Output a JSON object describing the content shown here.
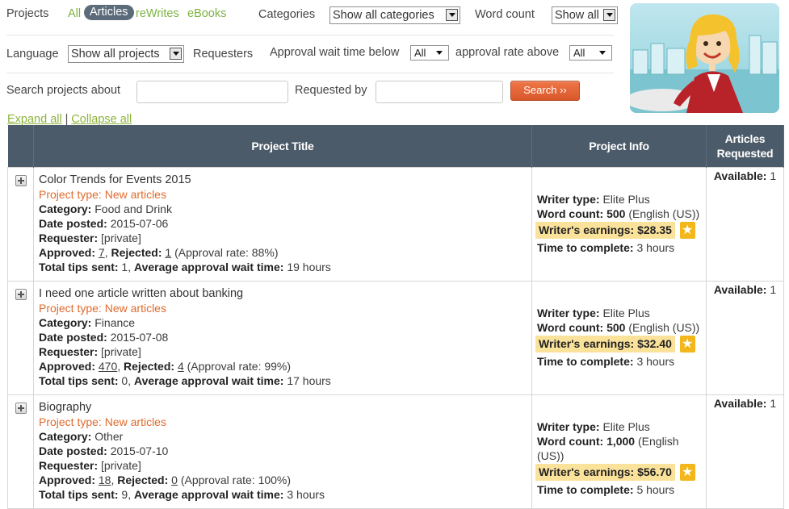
{
  "filters": {
    "projects_label": "Projects",
    "project_tabs": [
      {
        "label": "All",
        "active": false
      },
      {
        "label": "Articles",
        "active": true
      },
      {
        "label": "reWrites",
        "active": false
      },
      {
        "label": "eBooks",
        "active": false
      }
    ],
    "categories_label": "Categories",
    "categories_value": "Show all categories",
    "word_count_label": "Word count",
    "word_count_value": "Show all",
    "language_label": "Language",
    "language_value": "Show all projects",
    "requesters_label": "Requesters",
    "approval_wait_label": "Approval wait time below",
    "approval_wait_value": "All",
    "approval_rate_label": "approval rate above",
    "approval_rate_value": "All",
    "search_label": "Search projects about",
    "search_value": "",
    "requested_by_label": "Requested by",
    "requested_by_value": "",
    "search_button": "Search ››"
  },
  "expand": {
    "expand_all": "Expand all",
    "separator": "|",
    "collapse_all": "Collapse all"
  },
  "table": {
    "headers": [
      "Project Title",
      "Project Info",
      "Articles Requested"
    ],
    "rows": [
      {
        "title": "Color Trends for Events 2015",
        "project_type_label": "Project type:",
        "project_type": "New articles",
        "category_label": "Category:",
        "category": "Food and Drink",
        "date_label": "Date posted:",
        "date": "2015-07-06",
        "requester_label": "Requester:",
        "requester": "[private]",
        "approved_label": "Approved:",
        "approved": "7",
        "rejected_label": "Rejected:",
        "rejected": "1",
        "approval_rate_label": "(Approval rate:",
        "approval_rate": "88%)",
        "tips_label": "Total tips sent:",
        "tips": "1,",
        "wait_label": "Average approval wait time:",
        "wait": "19 hours",
        "writer_type_label": "Writer type:",
        "writer_type": "Elite Plus",
        "word_count_label": "Word count:",
        "word_count": "500",
        "language": "(English (US))",
        "earnings_label": "Writer's earnings:",
        "earnings": "$28.35",
        "time_label": "Time to complete:",
        "time": "3 hours",
        "available_label": "Available:",
        "available": "1"
      },
      {
        "title": "I need one article written about banking",
        "project_type_label": "Project type:",
        "project_type": "New articles",
        "category_label": "Category:",
        "category": "Finance",
        "date_label": "Date posted:",
        "date": "2015-07-08",
        "requester_label": "Requester:",
        "requester": "[private]",
        "approved_label": "Approved:",
        "approved": "470",
        "rejected_label": "Rejected:",
        "rejected": "4",
        "approval_rate_label": "(Approval rate:",
        "approval_rate": "99%)",
        "tips_label": "Total tips sent:",
        "tips": "0,",
        "wait_label": "Average approval wait time:",
        "wait": "17 hours",
        "writer_type_label": "Writer type:",
        "writer_type": "Elite Plus",
        "word_count_label": "Word count:",
        "word_count": "500",
        "language": "(English (US))",
        "earnings_label": "Writer's earnings:",
        "earnings": "$32.40",
        "time_label": "Time to complete:",
        "time": "3 hours",
        "available_label": "Available:",
        "available": "1"
      },
      {
        "title": "Biography",
        "project_type_label": "Project type:",
        "project_type": "New articles",
        "category_label": "Category:",
        "category": "Other",
        "date_label": "Date posted:",
        "date": "2015-07-10",
        "requester_label": "Requester:",
        "requester": "[private]",
        "approved_label": "Approved:",
        "approved": "18",
        "rejected_label": "Rejected:",
        "rejected": "0",
        "approval_rate_label": "(Approval rate:",
        "approval_rate": "100%)",
        "tips_label": "Total tips sent:",
        "tips": "9,",
        "wait_label": "Average approval wait time:",
        "wait": "3 hours",
        "writer_type_label": "Writer type:",
        "writer_type": "Elite Plus",
        "word_count_label": "Word count:",
        "word_count": "1,000",
        "language": "(English (US))",
        "earnings_label": "Writer's earnings:",
        "earnings": "$56.70",
        "time_label": "Time to complete:",
        "time": "5 hours",
        "available_label": "Available:",
        "available": "1"
      }
    ]
  },
  "icons": {
    "expand_row": "plus-box-icon",
    "featured": "star-badge-icon",
    "dropdown": "chevron-down-icon",
    "illustration": "writer-woman-illustration"
  },
  "colors": {
    "header_bg": "#4c5b69",
    "accent_green": "#7cb342",
    "accent_orange": "#e06a2c",
    "search_button": "#e4653a",
    "earnings_highlight": "#fbe29b",
    "star_badge": "#f3b71c"
  }
}
